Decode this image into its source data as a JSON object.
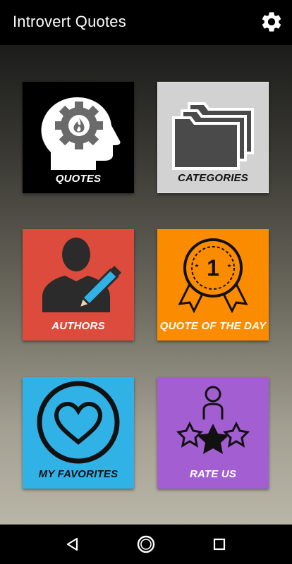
{
  "app_bar": {
    "title": "Introvert Quotes",
    "settings_icon": "gear-icon"
  },
  "tiles": [
    {
      "label": "QUOTES",
      "icon": "head-gear-fire-icon",
      "bg": "#000000",
      "text_color": "#ffffff"
    },
    {
      "label": "CATEGORIES",
      "icon": "folders-icon",
      "bg": "#d2d2d2",
      "text_color": "#000000"
    },
    {
      "label": "AUTHORS",
      "icon": "author-pencil-icon",
      "bg": "#dc4b3c",
      "text_color": "#ffffff"
    },
    {
      "label": "QUOTE OF THE DAY",
      "icon": "award-ribbon-icon",
      "bg": "#fb8c00",
      "text_color": "#ffffff"
    },
    {
      "label": "MY FAVORITES",
      "icon": "heart-circle-icon",
      "bg": "#31b2e6",
      "text_color": "#000000"
    },
    {
      "label": "RATE US",
      "icon": "person-stars-icon",
      "bg": "#a35fd2",
      "text_color": "#ffffff"
    }
  ],
  "nav_bar": {
    "back": "back-icon",
    "home": "home-icon",
    "recents": "recents-icon"
  }
}
